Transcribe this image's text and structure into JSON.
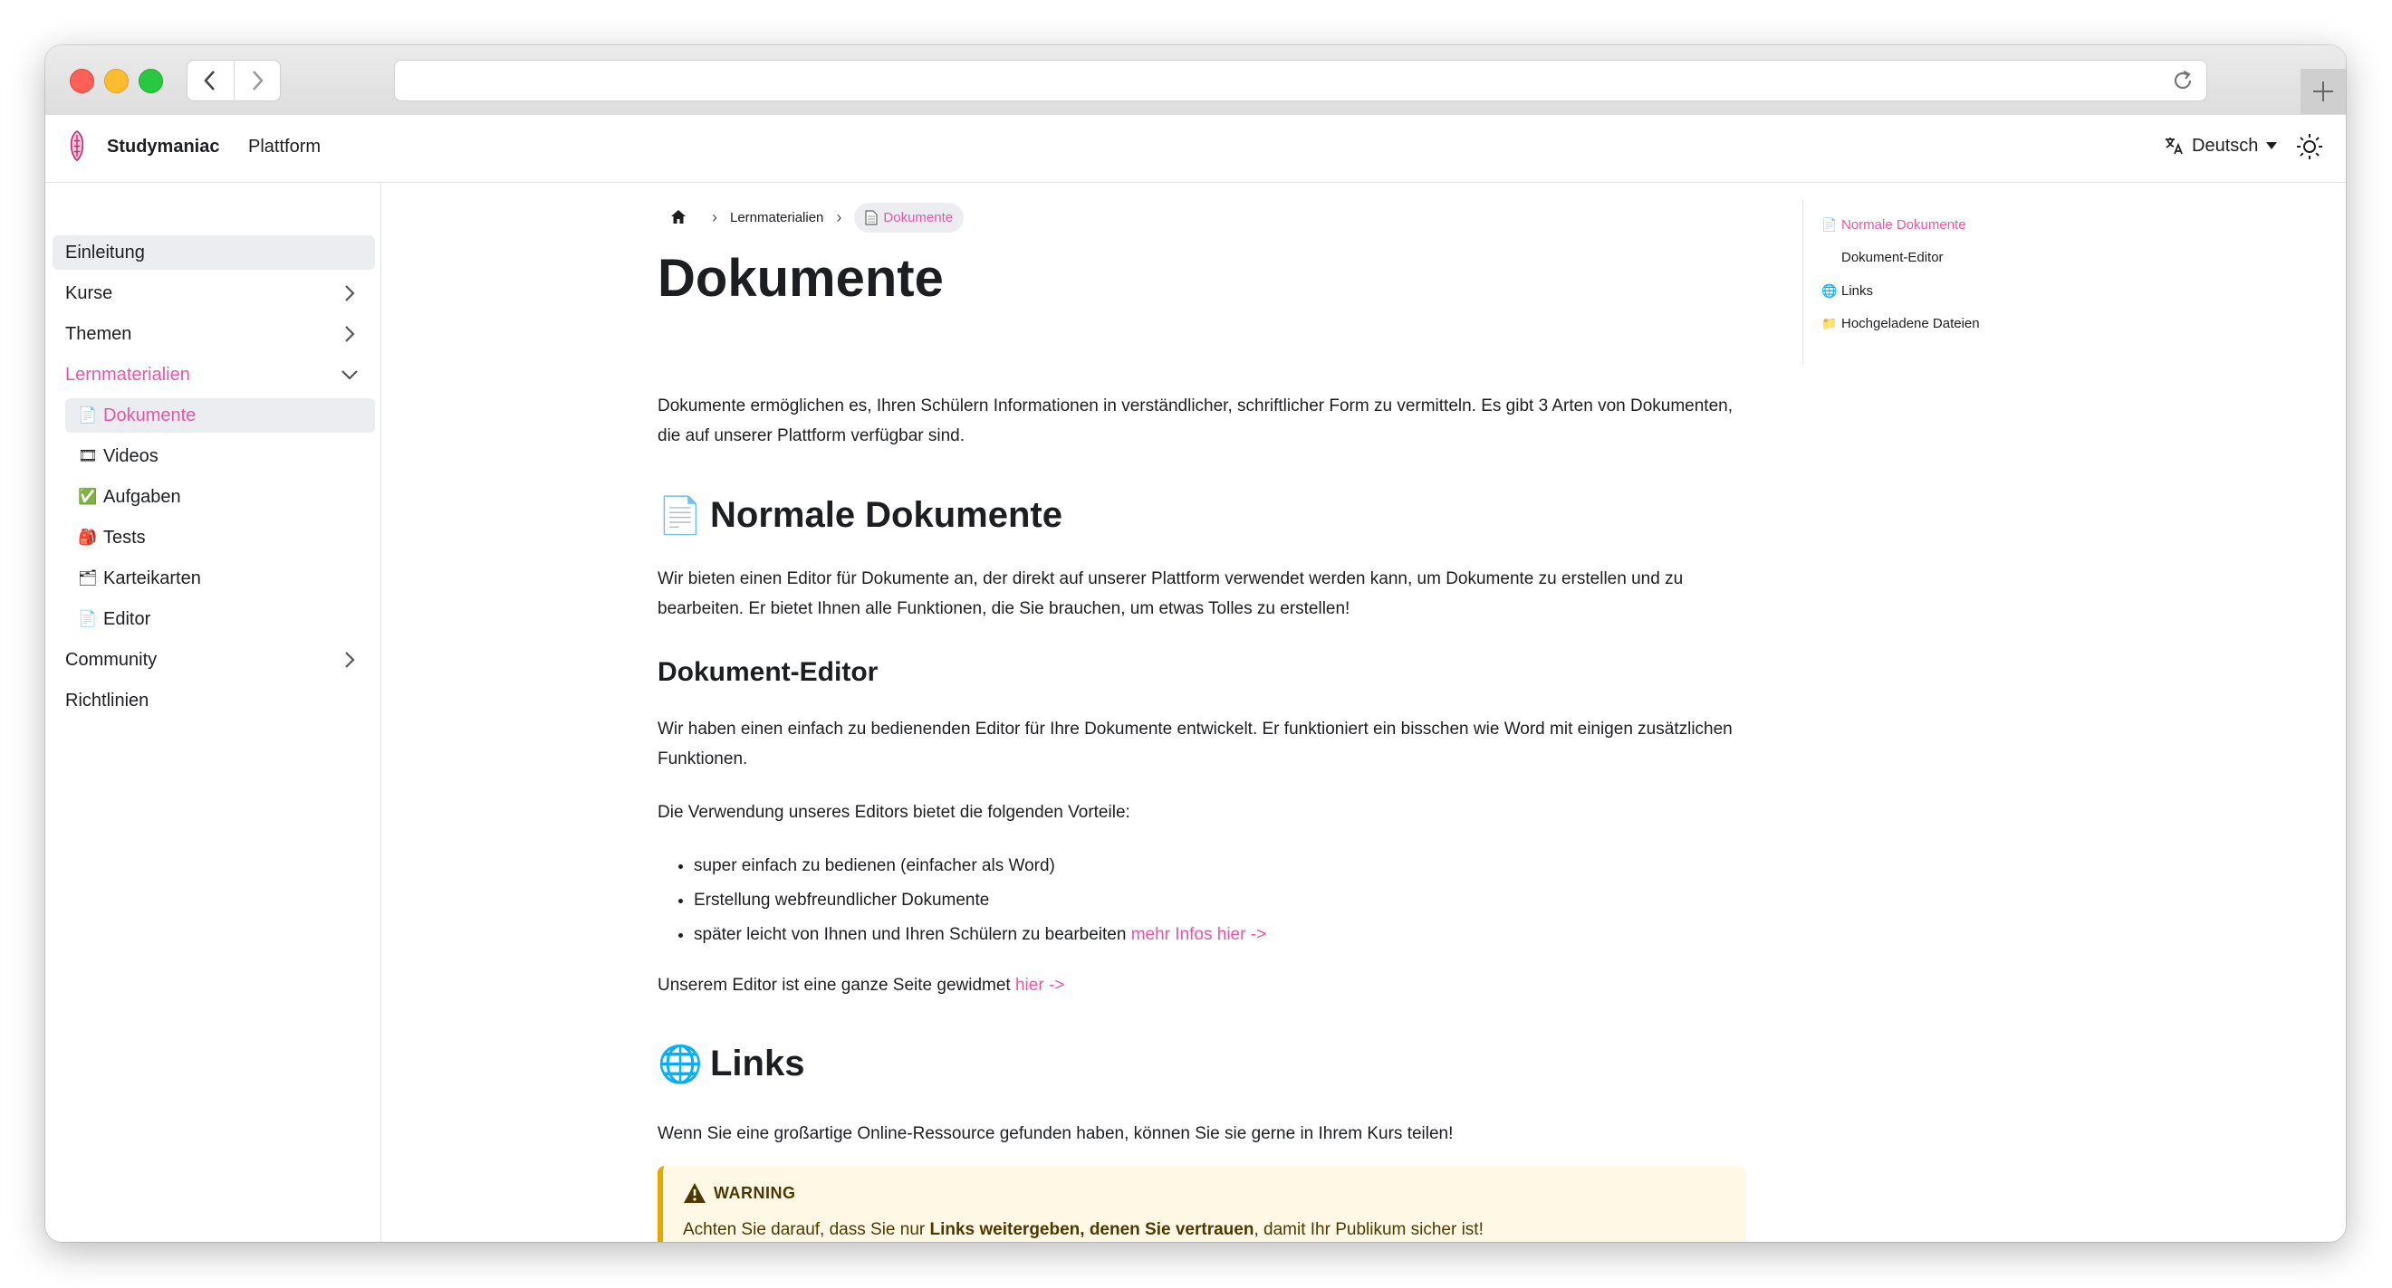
{
  "browser": {
    "url": ""
  },
  "navbar": {
    "brand": "Studymaniac",
    "link": "Plattform",
    "language": "Deutsch"
  },
  "sidebar": {
    "items": [
      {
        "label": "Einleitung"
      },
      {
        "label": "Kurse"
      },
      {
        "label": "Themen"
      },
      {
        "label": "Lernmaterialien"
      },
      {
        "label": "Community"
      },
      {
        "label": "Richtlinien"
      }
    ],
    "sub_items": [
      {
        "icon": "📄",
        "label": "Dokumente"
      },
      {
        "icon": "🎞",
        "label": "Videos"
      },
      {
        "icon": "✅",
        "label": "Aufgaben"
      },
      {
        "icon": "🎒",
        "label": "Tests"
      },
      {
        "icon": "🗂",
        "label": "Karteikarten"
      },
      {
        "icon": "📄",
        "label": "Editor"
      }
    ]
  },
  "breadcrumbs": {
    "level1": "Lernmaterialien",
    "current": "Dokumente"
  },
  "page": {
    "title": "Dokumente",
    "intro": "Dokumente ermöglichen es, Ihren Schülern Informationen in verständlicher, schriftlicher Form zu vermitteln. Es gibt 3 Arten von Dokumenten, die auf unserer Plattform verfügbar sind.",
    "section1": {
      "icon": "📄",
      "heading": "Normale Dokumente",
      "text": "Wir bieten einen Editor für Dokumente an, der direkt auf unserer Plattform verwendet werden kann, um Dokumente zu erstellen und zu bearbeiten. Er bietet Ihnen alle Funktionen, die Sie brauchen, um etwas Tolles zu erstellen!"
    },
    "subsection": {
      "heading": "Dokument-Editor",
      "text": "Wir haben einen einfach zu bedienenden Editor für Ihre Dokumente entwickelt. Er funktioniert ein bisschen wie Word mit einigen zusätzlichen Funktionen.",
      "advantages_intro": "Die Verwendung unseres Editors bietet die folgenden Vorteile:",
      "bullets": [
        "super einfach zu bedienen (einfacher als Word)",
        "Erstellung webfreundlicher Dokumente",
        "später leicht von Ihnen und Ihren Schülern zu bearbeiten "
      ],
      "bullet_link": "mehr Infos hier ->",
      "editor_text": "Unserem Editor ist eine ganze Seite gewidmet ",
      "editor_link": "hier ->"
    },
    "section2": {
      "icon": "🌐",
      "heading": "Links",
      "text": "Wenn Sie eine großartige Online-Ressource gefunden haben, können Sie sie gerne in Ihrem Kurs teilen!"
    },
    "warning": {
      "title": "WARNING",
      "text_before": "Achten Sie darauf, dass Sie nur ",
      "text_bold": "Links weitergeben, denen Sie vertrauen",
      "text_after": ", damit Ihr Publikum sicher ist!"
    }
  },
  "toc": [
    {
      "icon": "📄",
      "label": "Normale Dokumente"
    },
    {
      "icon": "",
      "label": "Dokument-Editor"
    },
    {
      "icon": "🌐",
      "label": "Links"
    },
    {
      "icon": "📁",
      "label": "Hochgeladene Dateien"
    }
  ],
  "colors": {
    "accent": "#e857a6",
    "warning_border": "#e6a700",
    "warning_bg": "#fef8e5"
  }
}
